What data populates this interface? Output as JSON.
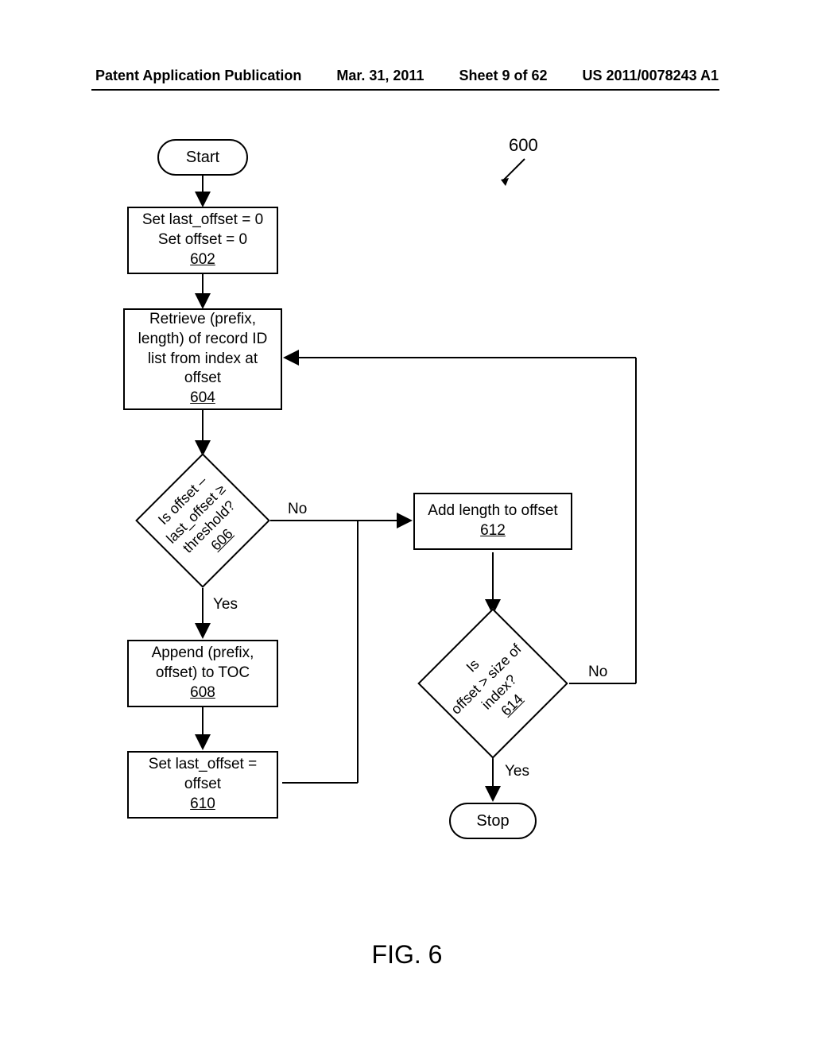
{
  "header": {
    "left": "Patent Application Publication",
    "mid": "Mar. 31, 2011",
    "sheet": "Sheet 9 of 62",
    "right": "US 2011/0078243 A1"
  },
  "figure": "FIG. 6",
  "ref600": "600",
  "start": "Start",
  "stop": "Stop",
  "b602": {
    "l1": "Set last_offset = 0",
    "l2": "Set offset = 0",
    "ref": "602"
  },
  "b604": {
    "l1": "Retrieve (prefix,",
    "l2": "length) of record ID",
    "l3": "list from index at",
    "l4": "offset",
    "ref": "604"
  },
  "b606": {
    "l1": "Is offset –",
    "l2": "last_offset ≥",
    "l3": "threshold?",
    "ref": "606"
  },
  "b608": {
    "l1": "Append (prefix,",
    "l2": "offset) to TOC",
    "ref": "608"
  },
  "b610": {
    "l1": "Set last_offset =",
    "l2": "offset",
    "ref": "610"
  },
  "b612": {
    "l1": "Add length to offset",
    "ref": "612"
  },
  "b614": {
    "l1": "Is",
    "l2": "offset > size of",
    "l3": "index?",
    "ref": "614"
  },
  "labels": {
    "yes": "Yes",
    "no": "No"
  }
}
